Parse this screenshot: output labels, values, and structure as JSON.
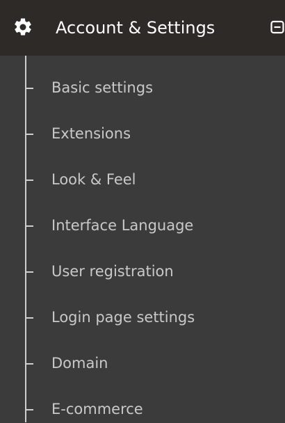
{
  "header": {
    "title": "Account & Settings",
    "icon": "gear-icon",
    "collapse_icon": "collapse-minus-icon"
  },
  "menu": {
    "items": [
      {
        "label": "Basic settings"
      },
      {
        "label": "Extensions"
      },
      {
        "label": "Look & Feel"
      },
      {
        "label": "Interface Language"
      },
      {
        "label": "User registration"
      },
      {
        "label": "Login page settings"
      },
      {
        "label": "Domain"
      },
      {
        "label": "E-commerce"
      }
    ]
  },
  "colors": {
    "header_bg": "#2e2a27",
    "panel_bg": "#3b3b3b",
    "title_text": "#ffffff",
    "item_text": "#c9c9c9",
    "tree_line": "#cfcfcf"
  }
}
